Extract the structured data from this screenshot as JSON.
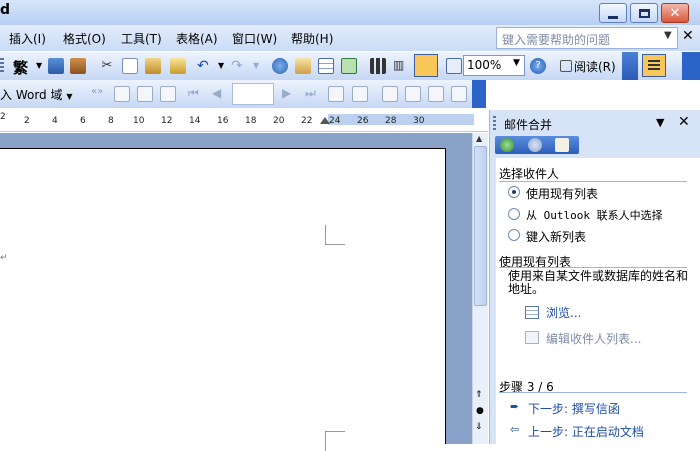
{
  "window": {
    "title_fragment": "d"
  },
  "menu": {
    "items": [
      "插入(I)",
      "格式(O)",
      "工具(T)",
      "表格(A)",
      "窗口(W)",
      "帮助(H)"
    ],
    "help_placeholder": "键入需要帮助的问题"
  },
  "toolbar": {
    "zoom": "100%",
    "read_label": "阅读(R)",
    "chinese_char": "繁"
  },
  "toolbar2": {
    "field_label": "入 Word 域"
  },
  "ruler": {
    "ticks": [
      "2",
      "2",
      "4",
      "6",
      "8",
      "10",
      "12",
      "14",
      "16",
      "18",
      "20",
      "22",
      "24",
      "26",
      "28",
      "30"
    ]
  },
  "task_pane": {
    "title": "邮件合并",
    "section1_title": "选择收件人",
    "options": [
      "使用现有列表",
      "从 Outlook 联系人中选择",
      "键入新列表"
    ],
    "selected_index": 0,
    "section2_title": "使用现有列表",
    "section2_desc": "使用来自某文件或数据库的姓名和地址。",
    "browse_link": "浏览...",
    "edit_link": "编辑收件人列表...",
    "step_label": "步骤 3 / 6",
    "next_step": "下一步: 撰写信函",
    "prev_step": "上一步: 正在启动文档"
  },
  "colors": {
    "accent": "#2b63c9",
    "pane_bg": "#d7e3f7",
    "link": "#1e4ca8"
  }
}
